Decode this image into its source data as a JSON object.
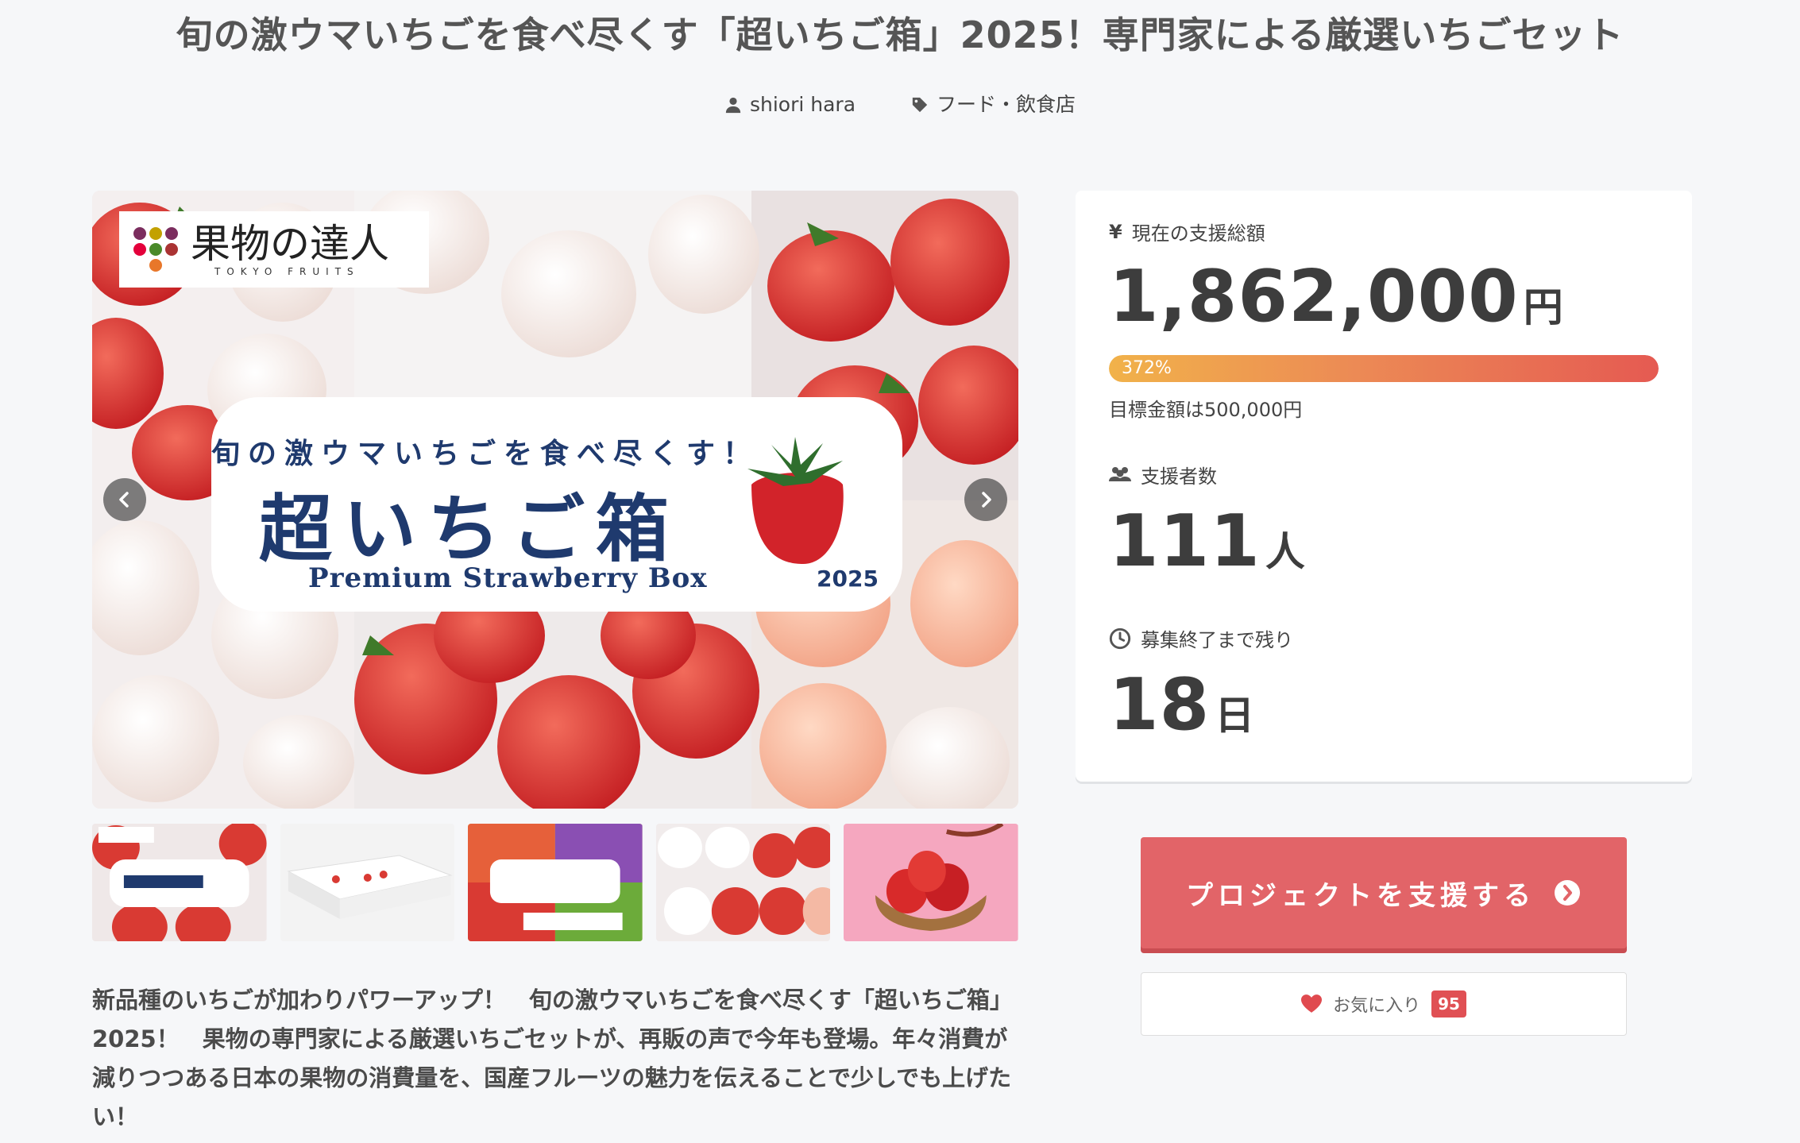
{
  "header": {
    "title": "旬の激ウマいちごを食べ尽くす「超いちご箱」2025！専門家による厳選いちごセット",
    "author": "shiori hara",
    "category": "フード・飲食店"
  },
  "hero": {
    "brand_name": "果物の達人",
    "brand_sub": "TOKYO FRUITS",
    "tagline": "旬の激ウマいちごを食べ尽くす！",
    "product_name": "超いちご箱",
    "product_en": "Premium Strawberry Box",
    "year": "2025",
    "thumbnails": [
      "thumb-1",
      "thumb-2",
      "thumb-3",
      "thumb-4",
      "thumb-5"
    ]
  },
  "description": "新品種のいちごが加わりパワーアップ！　旬の激ウマいちごを食べ尽くす「超いちご箱」2025！　果物の専門家による厳選いちごセットが、再販の声で今年も登場。年々消費が減りつつある日本の果物の消費量を、国産フルーツの魅力を伝えることで少しでも上げたい！",
  "stats": {
    "total_label": "現在の支援総額",
    "total_amount": "1,862,000",
    "total_unit": "円",
    "progress_percent_label": "372%",
    "progress_fraction": 1.0,
    "goal_text": "目標金額は500,000円",
    "backers_label": "支援者数",
    "backers_count": "111",
    "backers_unit": "人",
    "remaining_label": "募集終了まで残り",
    "remaining_days": "18",
    "remaining_unit": "日"
  },
  "actions": {
    "support_label": "プロジェクトを支援する",
    "favorite_label": "お気に入り",
    "favorite_count": "95"
  },
  "colors": {
    "accent": "#e26468",
    "progress_start": "#f1b24a",
    "progress_end": "#e55a52",
    "brand_navy": "#1f3a6e"
  }
}
